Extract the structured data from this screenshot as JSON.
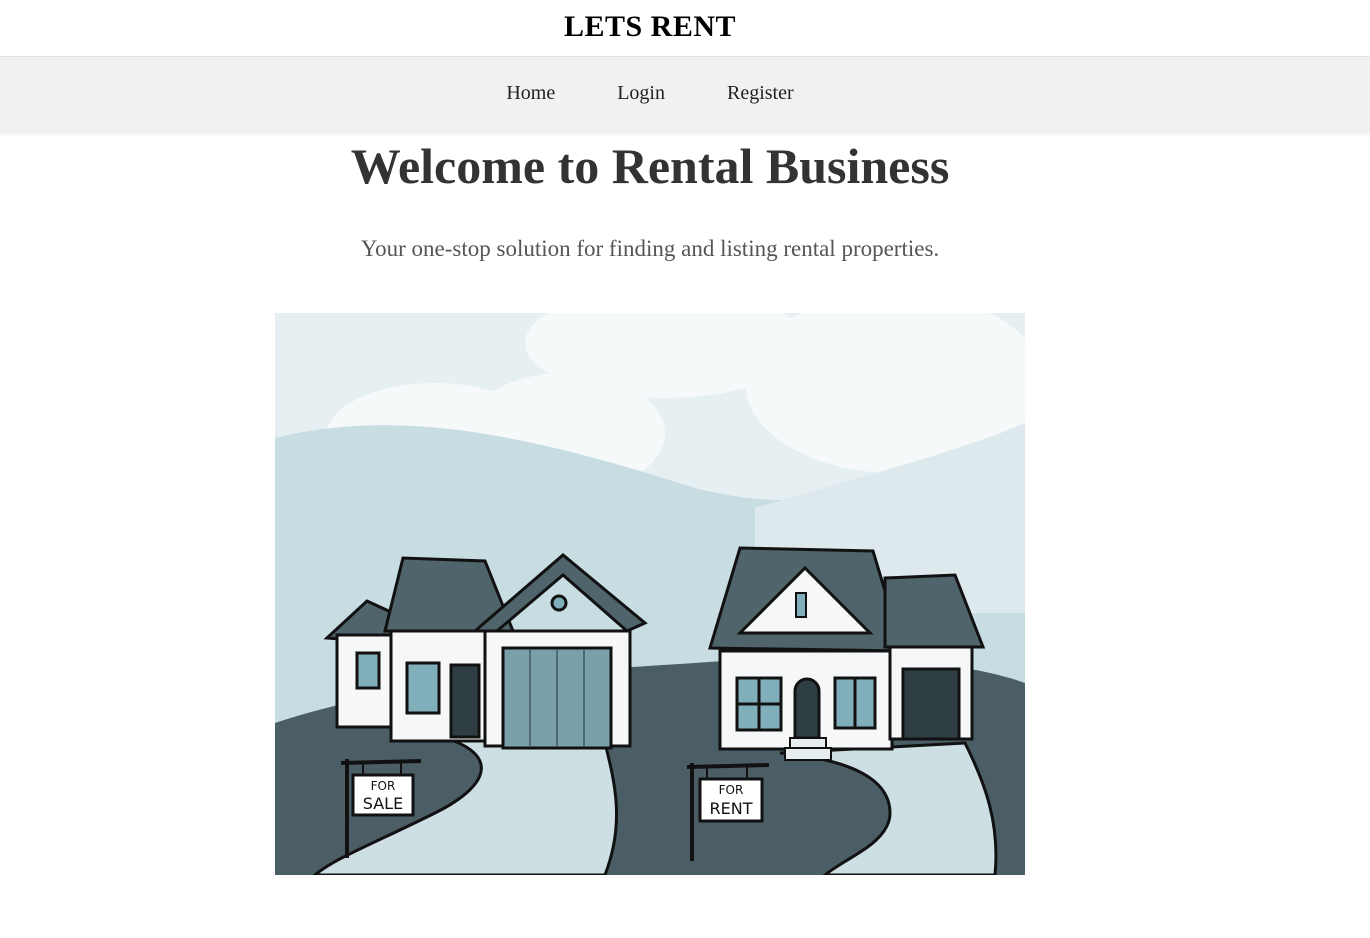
{
  "header": {
    "brand": "LETS RENT"
  },
  "nav": {
    "items": [
      {
        "label": "Home"
      },
      {
        "label": "Login"
      },
      {
        "label": "Register"
      }
    ]
  },
  "hero": {
    "title": "Welcome to Rental Business",
    "subtitle": "Your one-stop solution for finding and listing rental properties.",
    "illustration": {
      "sign_for_sale": "FOR SALE",
      "sign_for_rent": "FOR RENT"
    }
  },
  "colors": {
    "sky": "#e6f0f3",
    "hill_light": "#c8dde2",
    "ground_dark": "#4b5d65",
    "roof": "#4f646b",
    "driveway": "#cddfe3",
    "garage_door": "#7aa1ab",
    "window": "#80aebb"
  }
}
